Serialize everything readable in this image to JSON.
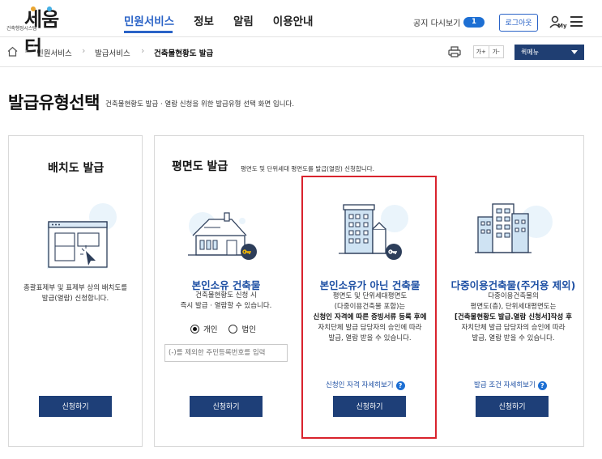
{
  "header": {
    "logo_sub": "건축행정시스템",
    "logo_main": "세움터",
    "nav": [
      "민원서비스",
      "정보",
      "알림",
      "이용안내"
    ],
    "notice_label": "공지 다시보기",
    "notice_count": "1",
    "logout_label": "로그아웃",
    "my_label": "My"
  },
  "breadcrumb": {
    "items": [
      "민원서비스",
      "발급서비스",
      "건축물현황도 발급"
    ],
    "font_large": "가+",
    "font_small": "가-",
    "quick_menu": "퀵메뉴"
  },
  "page": {
    "title": "발급유형선택",
    "description": "건축물현황도 발급 · 열람 신청을 위한 발급유형 선택 화면 입니다."
  },
  "left_panel": {
    "title": "배치도 발급",
    "desc_line1": "총괄표제부 및 표제부 상의 배치도를",
    "desc_line2": "발급(열람) 신청합니다.",
    "button": "신청하기"
  },
  "right_panel": {
    "title": "평면도 발급",
    "subtitle": "평면도 및 단위세대 평면도를 발급(열람) 신청합니다.",
    "cards": [
      {
        "title": "본인소유 건축물",
        "lines": [
          "건축물현황도 신청 시",
          "즉시 발급 · 열람할 수 있습니다."
        ],
        "radio_options": [
          "개인",
          "법인"
        ],
        "selected": "개인",
        "input_placeholder": "(-)를 제외한 주민등록번호를 입력",
        "button": "신청하기"
      },
      {
        "title": "본인소유가 아닌 건축물",
        "lines": [
          "평면도 및 단위세대평면도",
          "(다중이용건축물 포함)는"
        ],
        "bold_line": "신청인 자격에 따른 증빙서류 등록 후에",
        "lines2": [
          "자치단체 발급 담당자의 승인에 따라",
          "발급, 열람 받을 수 있습니다."
        ],
        "link": "신청인 자격 자세히보기",
        "button": "신청하기"
      },
      {
        "title": "다중이용건축물(주거용 제외)",
        "lines": [
          "다중이용건축물의",
          "평면도(층), 단위세대평면도는"
        ],
        "bold_line": "[건축물현황도 발급.열람 신청서]작성 후",
        "lines2": [
          "자치단체 발급 담당자의 승인에 따라",
          "발급, 열람 받을 수 있습니다."
        ],
        "link": "발급 조건 자세히보기",
        "button": "신청하기"
      }
    ]
  },
  "colors": {
    "brand_blue": "#2a63c7",
    "button_navy": "#1e3f78",
    "highlight_red": "#d9232d",
    "card_title_blue": "#1d4fa3"
  },
  "icons": [
    "home-icon",
    "print-icon",
    "menu-icon",
    "my-icon",
    "question-icon",
    "key-icon"
  ]
}
